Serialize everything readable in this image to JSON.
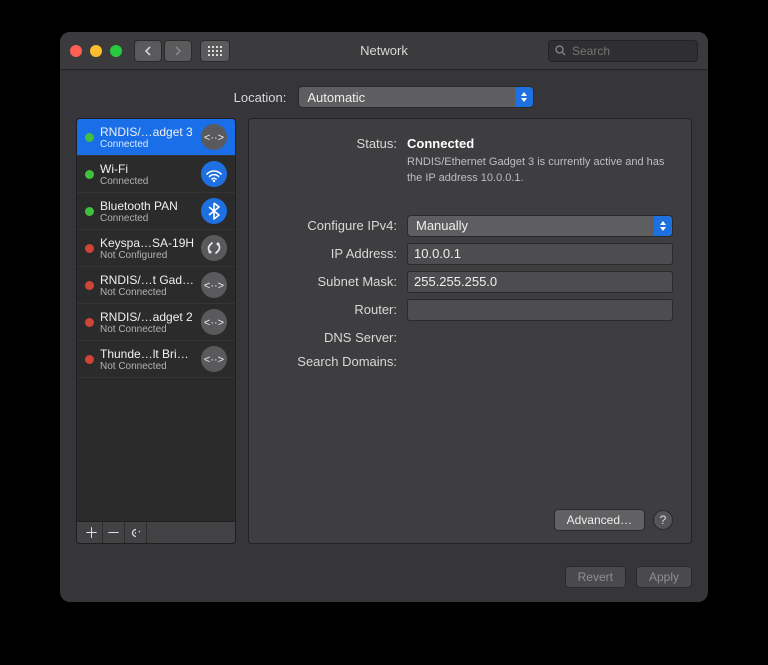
{
  "window": {
    "title": "Network"
  },
  "search": {
    "placeholder": "Search"
  },
  "location": {
    "label": "Location:",
    "value": "Automatic"
  },
  "sidebar": {
    "items": [
      {
        "name": "RNDIS/…adget 3",
        "sub": "Connected",
        "status": "green",
        "icon": "cable"
      },
      {
        "name": "Wi-Fi",
        "sub": "Connected",
        "status": "green",
        "icon": "wifi"
      },
      {
        "name": "Bluetooth PAN",
        "sub": "Connected",
        "status": "green",
        "icon": "bluetooth"
      },
      {
        "name": "Keyspa…SA-19H",
        "sub": "Not Configured",
        "status": "red",
        "icon": "serial"
      },
      {
        "name": "RNDIS/…t Gadget",
        "sub": "Not Connected",
        "status": "red",
        "icon": "cable"
      },
      {
        "name": "RNDIS/…adget 2",
        "sub": "Not Connected",
        "status": "red",
        "icon": "cable"
      },
      {
        "name": "Thunde…lt Bridge",
        "sub": "Not Connected",
        "status": "red",
        "icon": "cable"
      }
    ]
  },
  "status": {
    "label": "Status:",
    "value": "Connected",
    "desc": "RNDIS/Ethernet Gadget 3 is currently active and has the IP address 10.0.0.1."
  },
  "fields": {
    "configure_label": "Configure IPv4:",
    "configure_value": "Manually",
    "ip_label": "IP Address:",
    "ip_value": "10.0.0.1",
    "subnet_label": "Subnet Mask:",
    "subnet_value": "255.255.255.0",
    "router_label": "Router:",
    "router_value": "",
    "dns_label": "DNS Server:",
    "dns_value": "",
    "search_label": "Search Domains:",
    "search_value": ""
  },
  "buttons": {
    "advanced": "Advanced…",
    "revert": "Revert",
    "apply": "Apply"
  }
}
